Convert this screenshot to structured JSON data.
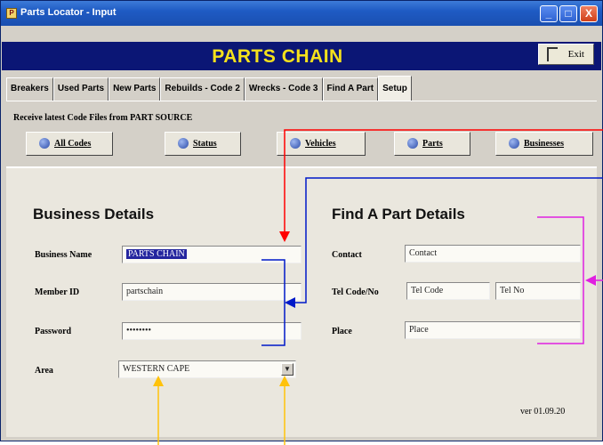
{
  "window": {
    "title": "Parts Locator - Input",
    "min_label": "_",
    "max_label": "□",
    "close_label": "X"
  },
  "banner": {
    "title": "PARTS CHAIN"
  },
  "exit_button": {
    "label": "Exit"
  },
  "tabs": [
    {
      "label": "Breakers"
    },
    {
      "label": "Used Parts"
    },
    {
      "label": "New Parts"
    },
    {
      "label": "Rebuilds - Code 2"
    },
    {
      "label": "Wrecks - Code 3"
    },
    {
      "label": "Find A Part"
    },
    {
      "label": "Setup"
    }
  ],
  "receive_label": "Receive latest Code Files from PART SOURCE",
  "code_buttons": [
    {
      "label": "All Codes"
    },
    {
      "label": "Status"
    },
    {
      "label": "Vehicles"
    },
    {
      "label": "Parts"
    },
    {
      "label": "Businesses"
    }
  ],
  "business": {
    "heading": "Business Details",
    "name_label": "Business Name",
    "name_value": "PARTS CHAIN",
    "member_label": "Member ID",
    "member_value": "partschain",
    "password_label": "Password",
    "password_value": "••••••••",
    "area_label": "Area",
    "area_value": "WESTERN CAPE"
  },
  "find": {
    "heading": "Find A Part Details",
    "contact_label": "Contact",
    "contact_value": "Contact",
    "tel_label": "Tel Code/No",
    "tel_code_value": "Tel Code",
    "tel_no_value": "Tel No",
    "place_label": "Place",
    "place_value": "Place"
  },
  "version": "ver 01.09.20",
  "annotation_colors": {
    "red": "#ff0000",
    "blue": "#0019c8",
    "magenta": "#e020e0",
    "yellow": "#ffc20a"
  }
}
